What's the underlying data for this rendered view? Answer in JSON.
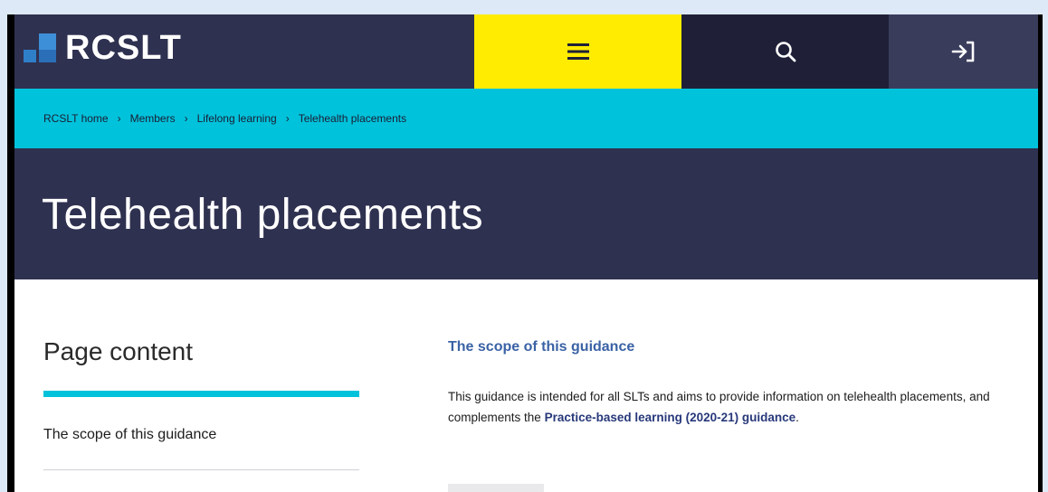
{
  "header": {
    "logo_text": "RCSLT",
    "menu_icon": "hamburger-icon",
    "search_icon": "search-icon",
    "login_icon": "login-icon"
  },
  "breadcrumb": {
    "items": [
      "RCSLT home",
      "Members",
      "Lifelong learning"
    ],
    "current": "Telehealth placements",
    "separator": "›"
  },
  "page": {
    "title": "Telehealth placements"
  },
  "toc": {
    "heading": "Page content",
    "items": [
      "The scope of this guidance"
    ]
  },
  "section": {
    "heading": "The scope of this guidance",
    "text_before": "This guidance is intended for all SLTs and aims to provide information on telehealth placements, and complements the ",
    "link_text": "Practice-based learning (2020-21) guidance",
    "text_after": "."
  },
  "colors": {
    "navy": "#2f3150",
    "yellow": "#ffec00",
    "cyan": "#00c2db",
    "link": "#3a62a5",
    "page_bg": "#dde9f6"
  }
}
